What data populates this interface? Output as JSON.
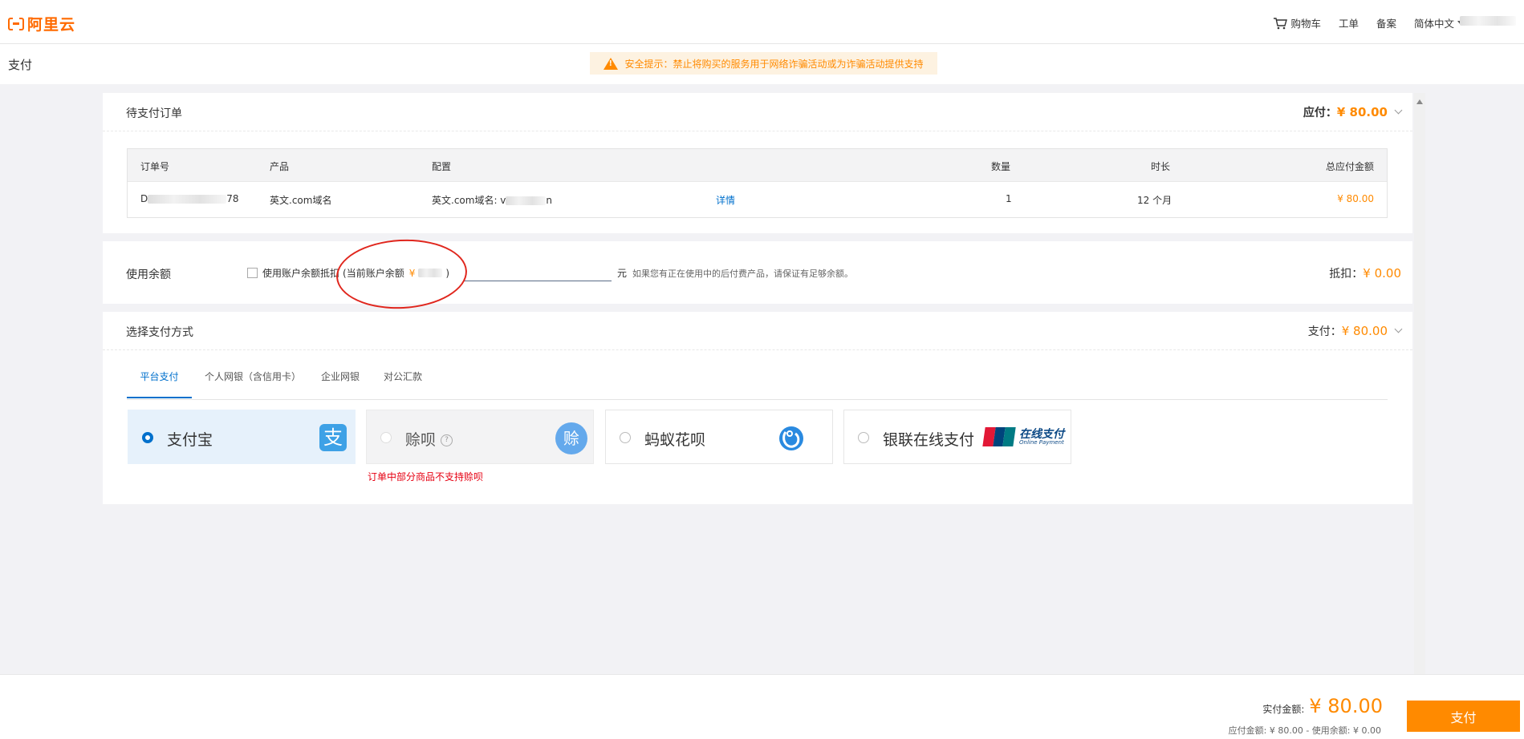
{
  "app": {
    "logo_text": "阿里云"
  },
  "nav": {
    "cart": "购物车",
    "ticket": "工单",
    "filing": "备案",
    "language": "简体中文"
  },
  "page": {
    "title": "支付",
    "security_notice": "安全提示：禁止将购买的服务用于网络诈骗活动或为诈骗活动提供支持"
  },
  "order": {
    "title": "待支付订单",
    "due_label": "应付：",
    "due_amount": "¥ 80.00",
    "columns": [
      "订单号",
      "产品",
      "配置",
      "数量",
      "时长",
      "总应付金额"
    ],
    "row": {
      "order_prefix": "D",
      "order_suffix": "78",
      "product": "英文.com域名",
      "config_prefix": "英文.com域名: v",
      "config_suffix": "n",
      "details": "详情",
      "quantity": "1",
      "duration": "12 个月",
      "total": "¥ 80.00"
    }
  },
  "balance": {
    "title": "使用余额",
    "checkbox_label": "使用账户余额抵扣",
    "current_prefix": "(当前账户余额",
    "currency": "¥",
    "current_suffix": ")",
    "unit": "元",
    "hint": "如果您有正在使用中的后付费产品，请保证有足够余额。",
    "deduct_label": "抵扣：",
    "deduct_amount": "¥ 0.00"
  },
  "payment": {
    "title": "选择支付方式",
    "pay_label": "支付：",
    "pay_amount": "¥ 80.00",
    "tabs": [
      "平台支付",
      "个人网银（含信用卡）",
      "企业网银",
      "对公汇款"
    ],
    "methods": [
      "支付宝",
      "赊呗",
      "蚂蚁花呗",
      "银联在线支付"
    ],
    "alipay_glyph": "支",
    "huabei_glyph": "赊",
    "unionpay_cn": "在线支付",
    "unionpay_en": "Online Payment",
    "help_glyph": "?",
    "huabei_note": "订单中部分商品不支持赊呗"
  },
  "footer": {
    "actual_label": "实付金额:",
    "actual_amount": "¥ 80.00",
    "detail": "应付金额: ¥ 80.00 - 使用余额: ¥ 0.00",
    "pay_button": "支付"
  },
  "colors": {
    "brand": "#ff6a00",
    "accent_orange": "#ff8a00",
    "link_blue": "#0070cc",
    "annotation_red": "#e0261d"
  },
  "icons": [
    "cart-icon",
    "warning-icon",
    "chevron-down-icon",
    "alipay-icon",
    "huabei-icon",
    "ant-huabei-icon",
    "unionpay-icon",
    "help-icon"
  ]
}
